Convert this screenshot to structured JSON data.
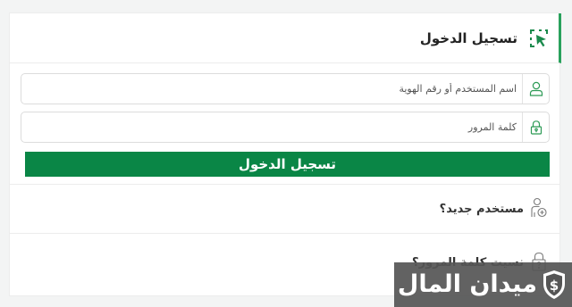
{
  "header": {
    "title": "تسجيل الدخول",
    "icon": "login-cursor-icon",
    "accent": "#29a15c"
  },
  "form": {
    "username": {
      "placeholder": "اسم المستخدم أو رقم الهوية",
      "value": "",
      "icon": "user-icon"
    },
    "password": {
      "placeholder": "كلمة المرور",
      "value": "",
      "icon": "lock-icon"
    },
    "submit_label": "تسجيل الدخول",
    "button_color": "#0a8646"
  },
  "links": {
    "new_user": {
      "label": "مستخدم جديد؟",
      "icon": "add-user-icon"
    },
    "forgot_password": {
      "label": "نسيت كلمة المرور؟",
      "icon": "lock-question-icon"
    }
  },
  "watermark": {
    "text": "ميدان المال",
    "logo": "shield-dollar-icon"
  }
}
